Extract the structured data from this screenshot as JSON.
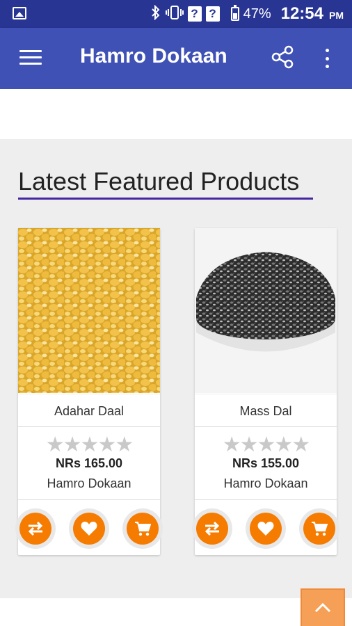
{
  "status_bar": {
    "battery_percent": "47%",
    "time": "12:54",
    "ampm": "PM",
    "icons": [
      "gallery-icon",
      "bluetooth-icon",
      "vibrate-icon",
      "no-sim-icon",
      "no-sim-icon",
      "battery-icon"
    ],
    "sim_glyph": "?"
  },
  "app_bar": {
    "title": "Hamro Dokaan",
    "icons": [
      "menu-icon",
      "share-icon",
      "more-vert-icon"
    ]
  },
  "section": {
    "title": "Latest Featured Products",
    "underline_color": "#4527a0"
  },
  "products": [
    {
      "name": "Adahar Daal",
      "price": "NRs 165.00",
      "vendor": "Hamro Dokaan",
      "rating_stars": "★★★★★",
      "rating": 0,
      "image": "yellow split lentils"
    },
    {
      "name": "Mass Dal",
      "price": "NRs 155.00",
      "vendor": "Hamro Dokaan",
      "rating_stars": "★★★★★",
      "rating": 0,
      "image": "black lentils in white bowl"
    }
  ],
  "card_actions": [
    "compare-icon",
    "heart-icon",
    "cart-icon"
  ],
  "colors": {
    "status_bar": "#283593",
    "app_bar": "#3f51b5",
    "accent_orange": "#f57c00",
    "scroll_top": "#f5a056"
  }
}
